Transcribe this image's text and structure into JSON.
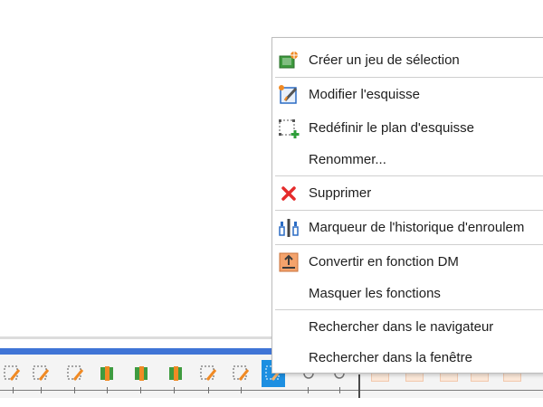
{
  "context_menu": {
    "items": [
      {
        "label": "Créer un jeu de sélection",
        "icon": "create-selection-set-icon"
      },
      {
        "label": "Modifier l'esquisse",
        "icon": "edit-sketch-icon"
      },
      {
        "label": "Redéfinir le plan d'esquisse",
        "icon": "redefine-sketch-plane-icon"
      },
      {
        "label": "Renommer...",
        "icon": null
      },
      {
        "label": "Supprimer",
        "icon": "delete-x-icon"
      },
      {
        "label": "Marqueur de l'historique d'enroulem",
        "icon": "history-marker-icon"
      },
      {
        "label": "Convertir en fonction DM",
        "icon": "convert-dm-icon"
      },
      {
        "label": "Masquer les fonctions",
        "icon": null
      },
      {
        "label": "Rechercher dans le navigateur",
        "icon": null
      },
      {
        "label": "Rechercher dans la fenêtre",
        "icon": null
      }
    ]
  },
  "colors": {
    "timeline_accent": "#3f74d6",
    "selected_item": "#1d8fe1",
    "delete_red": "#e52b2b",
    "sketch_orange": "#f08a24",
    "sketch_blue": "#2b6cc4"
  }
}
